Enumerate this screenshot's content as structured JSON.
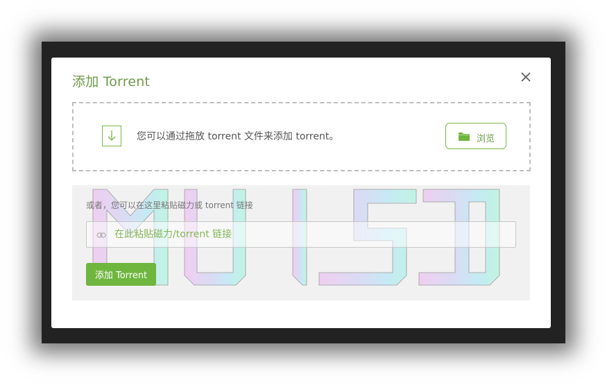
{
  "dialog": {
    "title": "添加 Torrent",
    "close_label": "close"
  },
  "drop_zone": {
    "text": "您可以通过拖放 torrent 文件来添加 torrent。",
    "browse_label": "浏览"
  },
  "paste_section": {
    "label": "或者，您可以在这里粘贴磁力或 torrent 链接",
    "input_placeholder": "在此粘贴磁力/torrent 链接",
    "input_value": "",
    "add_button_label": "添加 Torrent"
  },
  "icons": {
    "drop": "download-arrow-icon",
    "browse": "folder-icon",
    "link": "link-icon",
    "close": "close-icon"
  },
  "colors": {
    "accent": "#6fb63f",
    "accent_text": "#6f9a48",
    "backdrop": "#222222"
  }
}
